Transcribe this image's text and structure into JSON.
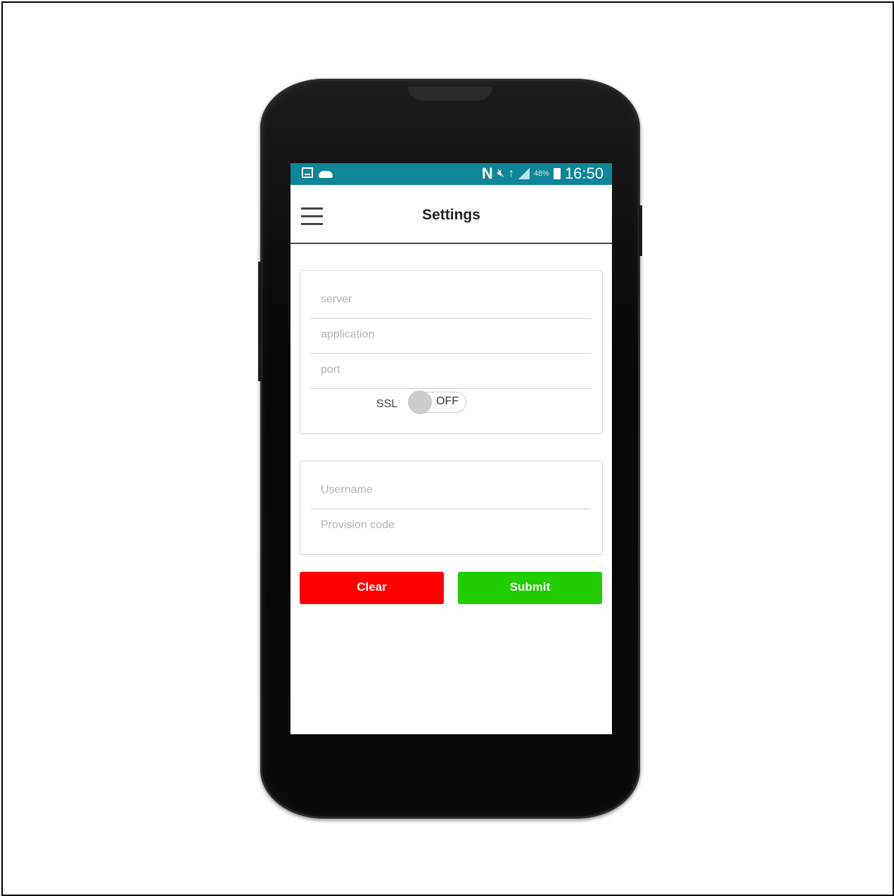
{
  "status_bar": {
    "time": "16:50",
    "battery": "48%",
    "carrier_letter": "N"
  },
  "app_bar": {
    "title": "Settings"
  },
  "server_card": {
    "server_placeholder": "server",
    "application_placeholder": "application",
    "port_placeholder": "port",
    "ssl_label": "SSL",
    "ssl_state": "OFF"
  },
  "account_card": {
    "username_placeholder": "Username",
    "provision_placeholder": "Provision code"
  },
  "actions": {
    "clear_label": "Clear",
    "submit_label": "Submit"
  },
  "colors": {
    "status_bar": "#0e8599",
    "clear": "#ff0000",
    "submit": "#22cc00"
  }
}
